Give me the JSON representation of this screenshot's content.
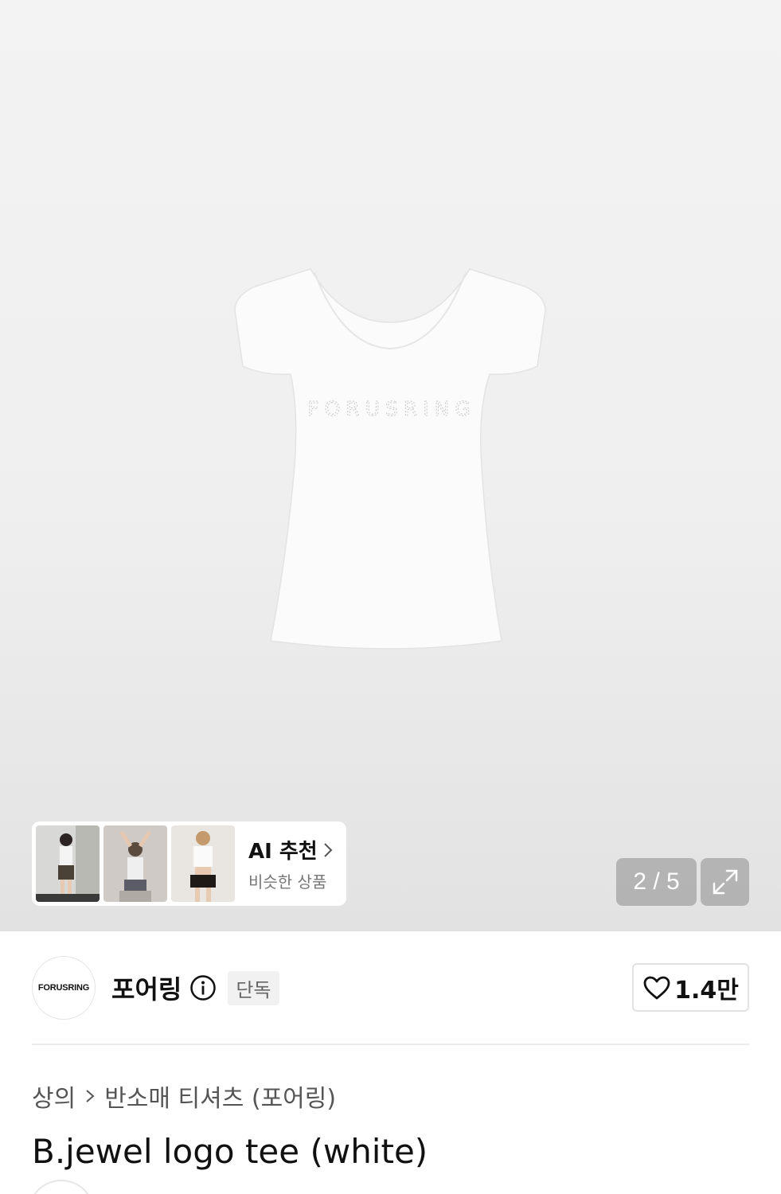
{
  "gallery": {
    "counter": "2 / 5",
    "product_print_text": "FORUSRING"
  },
  "ai_recommend": {
    "title": "AI 추천",
    "subtitle": "비슷한 상품"
  },
  "brand": {
    "logo_text": "FORUSRING",
    "name": "포어링",
    "badge": "단독",
    "likes": "1.4만"
  },
  "breadcrumb": {
    "category": "상의",
    "subcategory": "반소매 티셔츠 (포어링)"
  },
  "product": {
    "title": "B.jewel logo tee (white)"
  },
  "icons": {
    "info": "info-icon",
    "chevron": "chevron-right-icon",
    "expand": "expand-icon",
    "heart": "heart-icon"
  }
}
